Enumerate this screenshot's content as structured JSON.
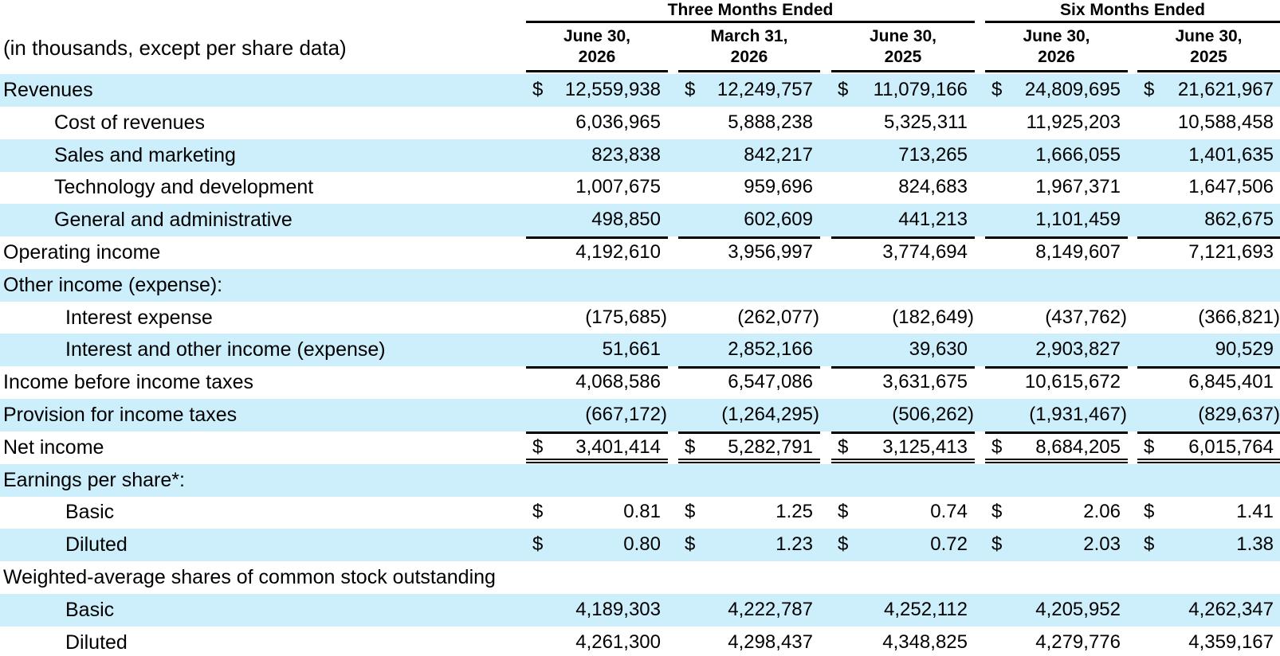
{
  "header": {
    "unit_label": "(in thousands, except per share data)",
    "groups": [
      "Three Months Ended",
      "Six Months Ended"
    ],
    "columns": [
      {
        "line1": "June 30,",
        "line2": "2026"
      },
      {
        "line1": "March 31,",
        "line2": "2026"
      },
      {
        "line1": "June 30,",
        "line2": "2025"
      },
      {
        "line1": "June 30,",
        "line2": "2026"
      },
      {
        "line1": "June 30,",
        "line2": "2025"
      }
    ]
  },
  "currency_symbol": "$",
  "rows": [
    {
      "label": "Revenues",
      "indent": 0,
      "band": true,
      "currency": true,
      "values": [
        "12,559,938",
        "12,249,757",
        "11,079,166",
        "24,809,695",
        "21,621,967"
      ]
    },
    {
      "label": "Cost of revenues",
      "indent": 1,
      "band": false,
      "values": [
        "6,036,965",
        "5,888,238",
        "5,325,311",
        "11,925,203",
        "10,588,458"
      ]
    },
    {
      "label": "Sales and marketing",
      "indent": 1,
      "band": true,
      "values": [
        "823,838",
        "842,217",
        "713,265",
        "1,666,055",
        "1,401,635"
      ]
    },
    {
      "label": "Technology and development",
      "indent": 1,
      "band": false,
      "values": [
        "1,007,675",
        "959,696",
        "824,683",
        "1,967,371",
        "1,647,506"
      ]
    },
    {
      "label": "General and administrative",
      "indent": 1,
      "band": true,
      "values": [
        "498,850",
        "602,609",
        "441,213",
        "1,101,459",
        "862,675"
      ]
    },
    {
      "label": "Operating income",
      "indent": 0,
      "band": false,
      "rule_top": true,
      "values": [
        "4,192,610",
        "3,956,997",
        "3,774,694",
        "8,149,607",
        "7,121,693"
      ]
    },
    {
      "label": "Other income (expense):",
      "indent": 0,
      "band": true,
      "values": []
    },
    {
      "label": "Interest expense",
      "indent": 2,
      "band": false,
      "values": [
        "(175,685)",
        "(262,077)",
        "(182,649)",
        "(437,762)",
        "(366,821)"
      ]
    },
    {
      "label": "Interest and other income (expense)",
      "indent": 2,
      "band": true,
      "values": [
        "51,661",
        "2,852,166",
        "39,630",
        "2,903,827",
        "90,529"
      ]
    },
    {
      "label": "Income before income taxes",
      "indent": 0,
      "band": false,
      "rule_top": true,
      "values": [
        "4,068,586",
        "6,547,086",
        "3,631,675",
        "10,615,672",
        "6,845,401"
      ]
    },
    {
      "label": "Provision for income taxes",
      "indent": 0,
      "band": true,
      "values": [
        "(667,172)",
        "(1,264,295)",
        "(506,262)",
        "(1,931,467)",
        "(829,637)"
      ]
    },
    {
      "label": "Net income",
      "indent": 0,
      "band": false,
      "rule_top": true,
      "double_bottom": true,
      "currency": true,
      "values": [
        "3,401,414",
        "5,282,791",
        "3,125,413",
        "8,684,205",
        "6,015,764"
      ]
    },
    {
      "label": "Earnings per share*:",
      "indent": 0,
      "band": true,
      "values": []
    },
    {
      "label": "Basic",
      "indent": 2,
      "band": false,
      "currency": true,
      "values": [
        "0.81",
        "1.25",
        "0.74",
        "2.06",
        "1.41"
      ]
    },
    {
      "label": "Diluted",
      "indent": 2,
      "band": true,
      "currency": true,
      "values": [
        "0.80",
        "1.23",
        "0.72",
        "2.03",
        "1.38"
      ]
    },
    {
      "label": "Weighted-average shares of common stock outstanding",
      "indent": 0,
      "band": false,
      "values": []
    },
    {
      "label": "Basic",
      "indent": 2,
      "band": true,
      "values": [
        "4,189,303",
        "4,222,787",
        "4,252,112",
        "4,205,952",
        "4,262,347"
      ]
    },
    {
      "label": "Diluted",
      "indent": 2,
      "band": false,
      "values": [
        "4,261,300",
        "4,298,437",
        "4,348,825",
        "4,279,776",
        "4,359,167"
      ]
    }
  ]
}
